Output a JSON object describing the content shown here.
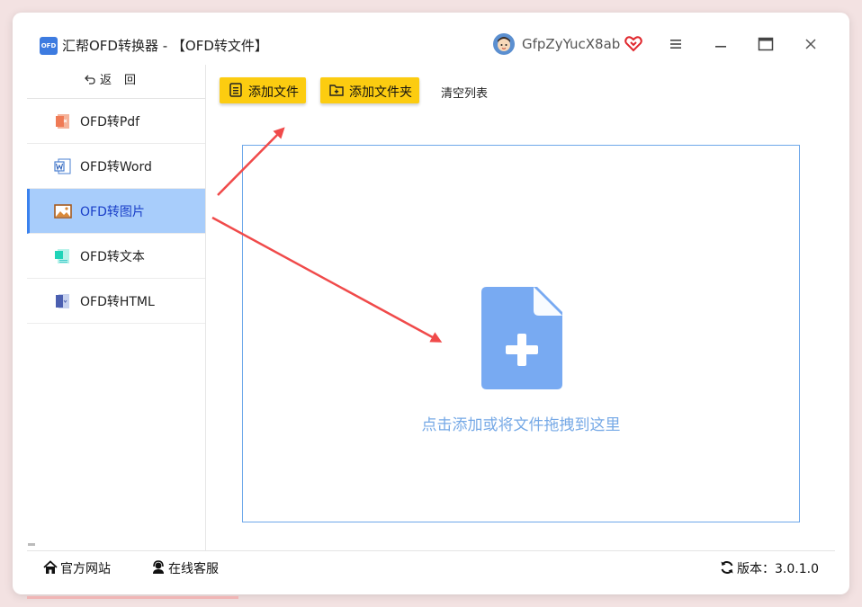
{
  "app": {
    "logo_text": "OFD",
    "title": "汇帮OFD转换器 - 【OFD转文件】"
  },
  "user": {
    "name": "GfpZyYucX8ab",
    "vip_color": "#e0282e"
  },
  "window_controls": [
    "menu-icon",
    "minimize-icon",
    "maximize-icon",
    "close-icon"
  ],
  "sidebar": {
    "back_icon": "back-arrow-icon",
    "back_label": "返回",
    "items": [
      {
        "label": "OFD转Pdf",
        "icon": "pdf-file-icon",
        "active": false
      },
      {
        "label": "OFD转Word",
        "icon": "word-file-icon",
        "active": false
      },
      {
        "label": "OFD转图片",
        "icon": "image-icon",
        "active": true
      },
      {
        "label": "OFD转文本",
        "icon": "text-file-icon",
        "active": false
      },
      {
        "label": "OFD转HTML",
        "icon": "html-file-icon",
        "active": false
      }
    ]
  },
  "toolbar": {
    "add_file_label": "添加文件",
    "add_folder_label": "添加文件夹",
    "clear_list_label": "清空列表",
    "button_color": "#fccc10"
  },
  "dropzone": {
    "icon": "add-file-icon",
    "hint": "点击添加或将文件拖拽到这里",
    "icon_color": "#78aaf2"
  },
  "statusbar": {
    "website_label": "官方网站",
    "support_label": "在线客服",
    "version_label": "版本：",
    "version": "3.0.1.0"
  },
  "annotations": {
    "arrow_color": "#f04a4a"
  },
  "colors": {
    "accent": "#3a82ee",
    "active_bg": "#a8cdfb",
    "active_text": "#1a3fc8"
  }
}
